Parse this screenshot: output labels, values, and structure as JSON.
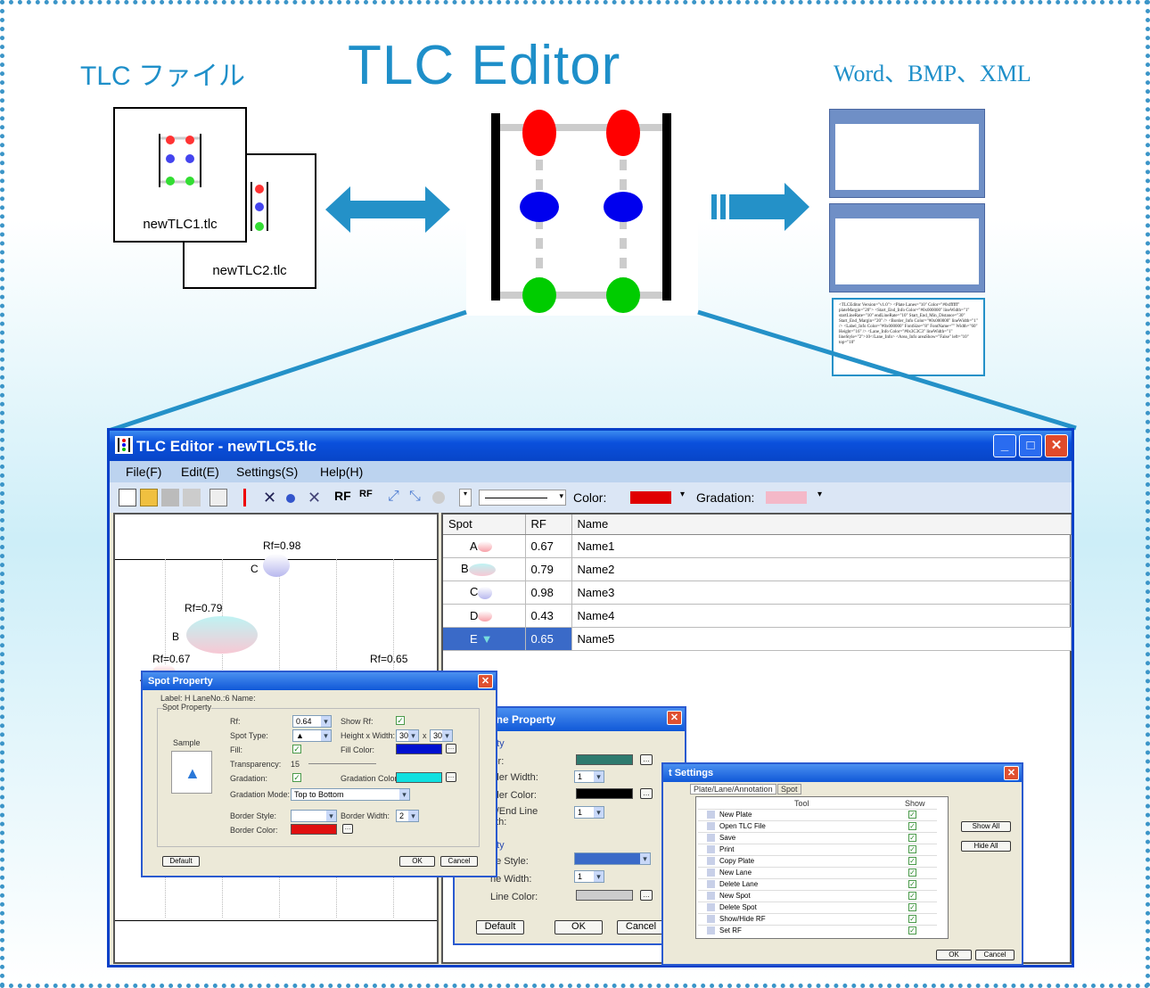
{
  "header": {
    "left_text": "TLC ファイル",
    "title": "TLC Editor",
    "right_text": "Word、BMP、XML"
  },
  "files": [
    {
      "label": "newTLC1.tlc"
    },
    {
      "label": "newTLC2.tlc"
    }
  ],
  "xml_snippet": "<TLCEditor Version=\"v1.0\"> <Plate Lanes=\"10\" Color=\"#0xffffff\" plateMargin=\"20\"> <Start_End_Info Color=\"#0x000000\" lineWidth=\"1\" startLineRate=\"10\" endLineRate=\"10\" Start_End_Min_Distance=\"30\" Start_End_Margin=\"20\" /> <Border_Info Color=\"#0x000000\" lineWidth=\"1\" /> <Label_Info Color=\"#0x000000\" FontSize=\"8\" FontName=\"\" Width=\"60\" Height=\"16\" /> <Lane_Info Color=\"#0x3C3C3\" lineWidth=\"1\" lineStyle=\"2\">10</Lane_Info> <Area_Info areaShow=\"False\" left=\"10\" top=\"10\"",
  "window": {
    "title": "TLC Editor - newTLC5.tlc",
    "menu": [
      "File(F)",
      "Edit(E)",
      "Settings(S)",
      "Help(H)"
    ],
    "toolbar": {
      "color_label": "Color:",
      "gradation_label": "Gradation:",
      "color": "#e00000",
      "gradation": "#f4b8c8"
    },
    "plate": {
      "labels": [
        {
          "text": "Rf=0.98"
        },
        {
          "text": "C"
        },
        {
          "text": "Rf=0.79"
        },
        {
          "text": "B"
        },
        {
          "text": "Rf=0.67"
        },
        {
          "text": "A"
        },
        {
          "text": "Rf=0.65"
        }
      ]
    },
    "table": {
      "headers": [
        "Spot",
        "RF",
        "Name"
      ],
      "rows": [
        {
          "spot": "A",
          "rf": "0.67",
          "name": "Name1"
        },
        {
          "spot": "B",
          "rf": "0.79",
          "name": "Name2"
        },
        {
          "spot": "C",
          "rf": "0.98",
          "name": "Name3"
        },
        {
          "spot": "D",
          "rf": "0.43",
          "name": "Name4"
        },
        {
          "spot": "E",
          "rf": "0.65",
          "name": "Name5"
        }
      ]
    }
  },
  "spot_property": {
    "title": "Spot Property",
    "label_row": "Label: H   LaneNo.:6     Name:",
    "group": "Spot Property",
    "sample": "Sample",
    "rf_label": "Rf:",
    "rf": "0.64",
    "show_rf": "Show Rf:",
    "spot_type": "Spot Type:",
    "spot_type_val": "▲",
    "hw": "Height x Width:",
    "h": "30",
    "x": "x",
    "w": "30",
    "fill": "Fill:",
    "fill_color": "Fill Color:",
    "transparency": "Transparency:",
    "transparency_val": "15",
    "gradation": "Gradation:",
    "gradation_color": "Gradation Color:",
    "gradation_mode": "Gradation Mode:",
    "gradation_mode_val": "Top to Bottom",
    "border_style": "Border Style:",
    "border_width": "Border Width:",
    "border_width_val": "2",
    "border_color": "Border Color:",
    "default": "Default",
    "ok": "OK",
    "cancel": "Cancel"
  },
  "lane_property": {
    "title": "ane Property",
    "group1": "Property",
    "color": "lor:",
    "border_width": "rder Width:",
    "bw_val": "1",
    "border_color": "rder Color:",
    "start_end": "rt/End Line",
    "width": "dth:",
    "sel_val": "1",
    "group2": "Property",
    "line_style": "ne Style:",
    "line_width": "ne Width:",
    "lw_val": "1",
    "line_color": "Line Color:",
    "default": "Default",
    "ok": "OK",
    "cancel": "Cancel"
  },
  "settings": {
    "title": "t Settings",
    "tabs": [
      "Plate/Lane/Annotation",
      "Spot"
    ],
    "col_tool": "Tool",
    "col_show": "Show",
    "items": [
      "New Plate",
      "Open TLC File",
      "Save",
      "Print",
      "Copy Plate",
      "New Lane",
      "Delete Lane",
      "New Spot",
      "Delete Spot",
      "Show/Hide RF",
      "Set RF"
    ],
    "show_all": "Show All",
    "hide_all": "Hide All",
    "ok": "OK",
    "cancel": "Cancel"
  }
}
